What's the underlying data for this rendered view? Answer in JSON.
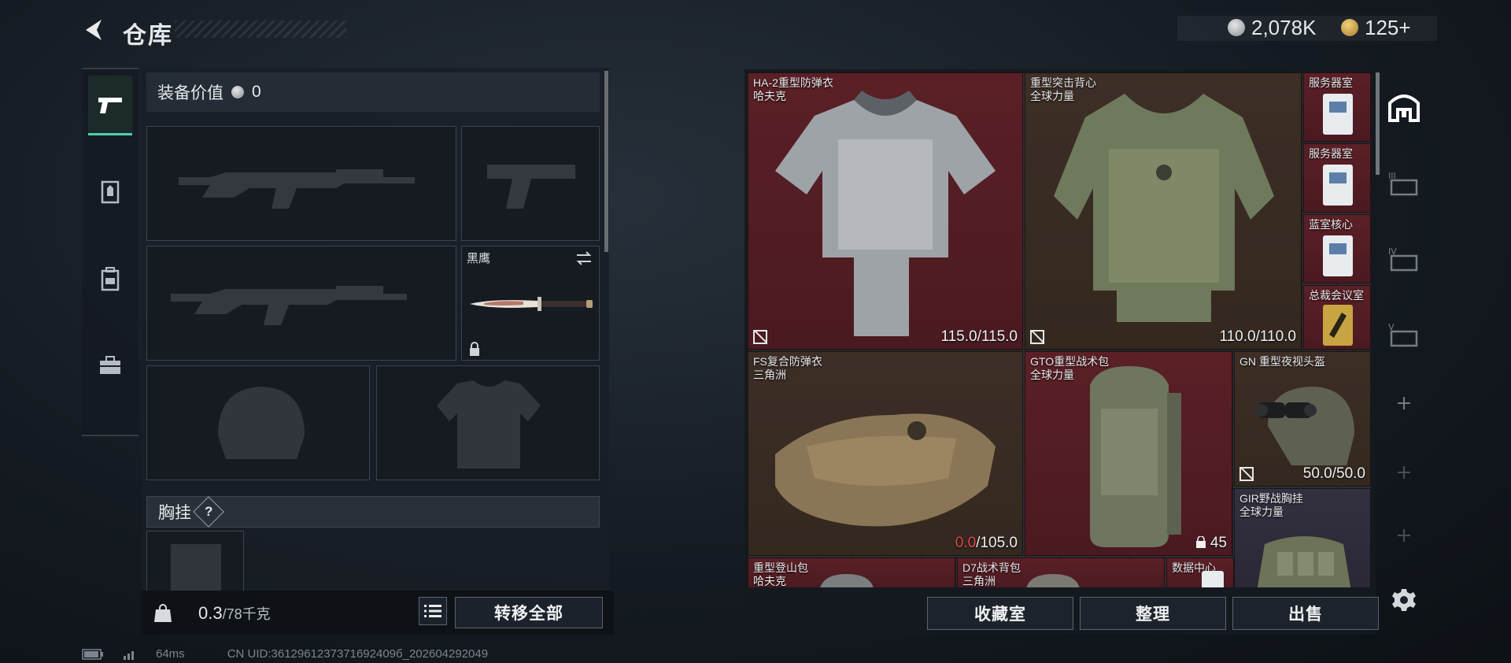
{
  "header": {
    "title": "仓库",
    "currency1": "2,078K",
    "currency2": "125+"
  },
  "loadout": {
    "value_label": "装备价值",
    "value": "0",
    "melee_name": "黑鹰",
    "chest_rig_label": "胸挂",
    "help": "?"
  },
  "footer_bar": {
    "weight": "0.3",
    "capacity": "/78千克",
    "transfer_all": "转移全部"
  },
  "storage": {
    "items": [
      {
        "name": "HA-2重型防弹衣",
        "maker": "哈夫克",
        "durability": "115.0/115.0"
      },
      {
        "name": "重型突击背心",
        "maker": "全球力量",
        "durability": "110.0/110.0"
      },
      {
        "name": "服务器室",
        "maker": ""
      },
      {
        "name": "服务器室",
        "maker": ""
      },
      {
        "name": "蓝室核心",
        "maker": ""
      },
      {
        "name": "总裁会议室",
        "maker": ""
      },
      {
        "name": "FS复合防弹衣",
        "maker": "三角洲",
        "durability_lost": "0.0",
        "durability_max": "/105.0"
      },
      {
        "name": "GTO重型战术包",
        "maker": "全球力量",
        "count": "45"
      },
      {
        "name": "GN 重型夜视头盔",
        "maker": "",
        "durability": "50.0/50.0"
      },
      {
        "name": "GIR野战胸挂",
        "maker": "全球力量"
      },
      {
        "name": "重型登山包",
        "maker": "哈夫克"
      },
      {
        "name": "D7战术背包",
        "maker": "三角洲"
      },
      {
        "name": "数据中心",
        "maker": ""
      }
    ],
    "buttons": {
      "vault": "收藏室",
      "sort": "整理",
      "sell": "出售"
    }
  },
  "status": {
    "ping": "64ms",
    "uid": "CN UID:3612961237371692409б_202604292049"
  },
  "colors": {
    "accent": "#4fd0a8",
    "red_rarity": "#5a2026",
    "brown_rarity": "#3d2e26",
    "purple_rarity": "#33303f",
    "durability_lost": "#e0474a"
  }
}
